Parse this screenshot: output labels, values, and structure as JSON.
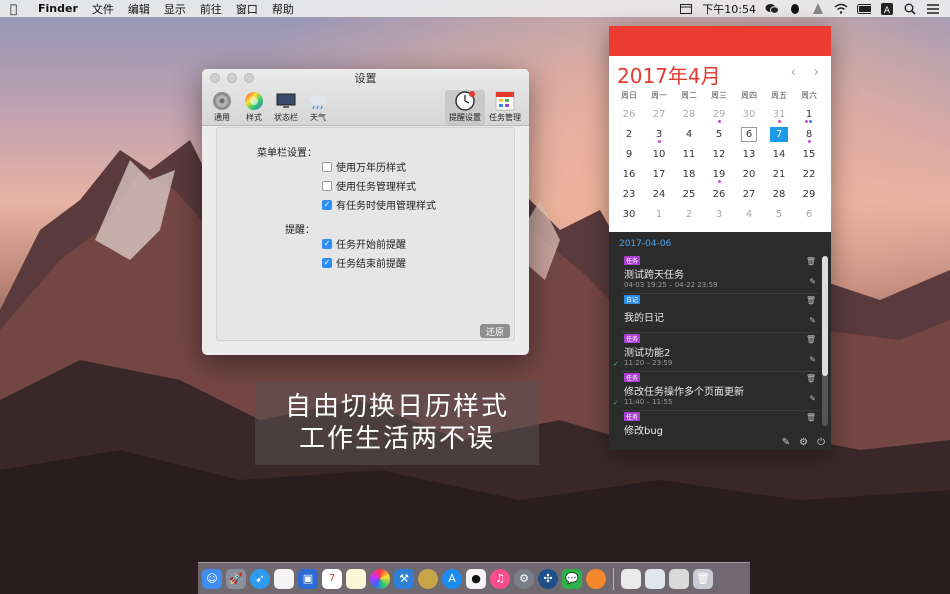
{
  "menubar": {
    "app_name": "Finder",
    "menus": [
      "文件",
      "编辑",
      "显示",
      "前往",
      "窗口",
      "帮助"
    ],
    "time": "下午10:54",
    "status_icons": [
      "calendar-icon",
      "wechat-icon",
      "qq-icon",
      "jpush-icon",
      "wifi-icon",
      "battery-icon",
      "input-method-icon",
      "search-icon",
      "list-icon"
    ]
  },
  "settings_window": {
    "title": "设置",
    "toolbar": [
      {
        "label": "通用",
        "icon": "gear-icon"
      },
      {
        "label": "样式",
        "icon": "color-wheel-icon"
      },
      {
        "label": "状态栏",
        "icon": "display-icon"
      },
      {
        "label": "天气",
        "icon": "weather-icon"
      },
      {
        "label": "提醒设置",
        "icon": "clock-icon"
      },
      {
        "label": "任务管理",
        "icon": "calendar-grid-icon"
      }
    ],
    "menubar_section_label": "菜单栏设置：",
    "menubar_options": [
      {
        "label": "使用万年历样式",
        "checked": false
      },
      {
        "label": "使用任务管理样式",
        "checked": false
      },
      {
        "label": "有任务时使用管理样式",
        "checked": true
      }
    ],
    "reminder_section_label": "提醒：",
    "reminder_options": [
      {
        "label": "任务开始前提醒",
        "checked": true
      },
      {
        "label": "任务结束前提醒",
        "checked": true
      }
    ],
    "restore_label": "还原"
  },
  "caption": {
    "line1": "自由切换日历样式",
    "line2": "工作生活两不误"
  },
  "calendar": {
    "month_title": "2017年4月",
    "prev_icon": "‹",
    "next_icon": "›",
    "weekdays": [
      "周日",
      "周一",
      "周二",
      "周三",
      "周四",
      "周五",
      "周六"
    ],
    "weeks": [
      [
        "26",
        "27",
        "28",
        "29",
        "30",
        "31",
        "1"
      ],
      [
        "2",
        "3",
        "4",
        "5",
        "6",
        "7",
        "8"
      ],
      [
        "9",
        "10",
        "11",
        "12",
        "13",
        "14",
        "15"
      ],
      [
        "16",
        "17",
        "18",
        "19",
        "20",
        "21",
        "22"
      ],
      [
        "23",
        "24",
        "25",
        "26",
        "27",
        "28",
        "29"
      ],
      [
        "30",
        "1",
        "2",
        "3",
        "4",
        "5",
        "6"
      ]
    ],
    "today": "6",
    "selected": "7",
    "task_date": "2017-04-06",
    "tasks": [
      {
        "tag": "任务",
        "tag_color": "#a93fd3",
        "title": "测试跨天任务",
        "time": "04-03 19:25 – 04-22 23:59",
        "done": false
      },
      {
        "tag": "日记",
        "tag_color": "#2e8de6",
        "title": "我的日记",
        "time": "",
        "done": false
      },
      {
        "tag": "任务",
        "tag_color": "#a93fd3",
        "title": "测试功能2",
        "time": "11:20 – 23:59",
        "done": true
      },
      {
        "tag": "任务",
        "tag_color": "#a93fd3",
        "title": "修改任务操作多个页面更新",
        "time": "11:40 – 11:55",
        "done": true
      },
      {
        "tag": "任务",
        "tag_color": "#a93fd3",
        "title": "修改bug",
        "time": "",
        "done": false
      }
    ]
  },
  "dock": {
    "apps": [
      "finder-icon",
      "launchpad-icon",
      "safari-icon",
      "calendar-app-icon",
      "notes-icon",
      "photos-icon",
      "xcode-icon",
      "app-store-icon",
      "qq-icon",
      "itunes-icon",
      "system-preferences-icon",
      "sourcetree-icon",
      "wechat-icon",
      "firefox-icon",
      "preview-icon",
      "trash-icon"
    ],
    "calendar_day": "7"
  },
  "colors": {
    "accent_red": "#ec3b30",
    "selected_blue": "#1e9be8",
    "task_purple": "#a93fd3",
    "diary_blue": "#2e8de6"
  }
}
